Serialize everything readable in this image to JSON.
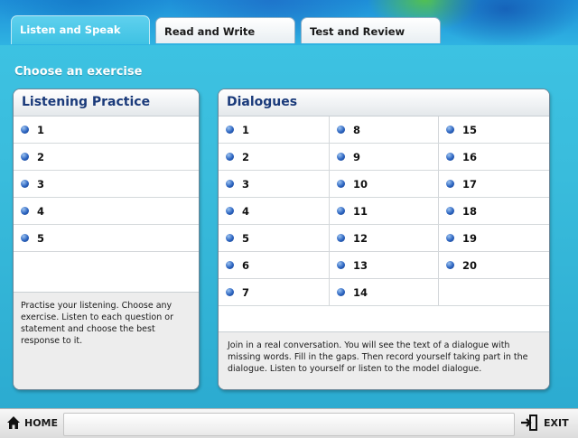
{
  "tabs": [
    {
      "label": "Listen and Speak",
      "active": true
    },
    {
      "label": "Read and Write",
      "active": false
    },
    {
      "label": "Test and Review",
      "active": false
    }
  ],
  "section_title": "Choose an exercise",
  "listening": {
    "title": "Listening Practice",
    "items": [
      "1",
      "2",
      "3",
      "4",
      "5"
    ],
    "description": "Practise your listening. Choose any exercise. Listen to each question or statement and choose the best response to it."
  },
  "dialogues": {
    "title": "Dialogues",
    "columns": [
      [
        "1",
        "2",
        "3",
        "4",
        "5",
        "6",
        "7"
      ],
      [
        "8",
        "9",
        "10",
        "11",
        "12",
        "13",
        "14"
      ],
      [
        "15",
        "16",
        "17",
        "18",
        "19",
        "20"
      ]
    ],
    "description": "Join in a real conversation. You will see the text of a dialogue with missing words. Fill in the gaps. Then record yourself taking part in the dialogue. Listen to yourself or listen to the model dialogue."
  },
  "footer": {
    "home_label": "HOME",
    "exit_label": "EXIT"
  },
  "colors": {
    "accent_bullet": "#2c64c0",
    "title_blue": "#1a3a7a",
    "bg_cyan": "#3ec4e4"
  }
}
